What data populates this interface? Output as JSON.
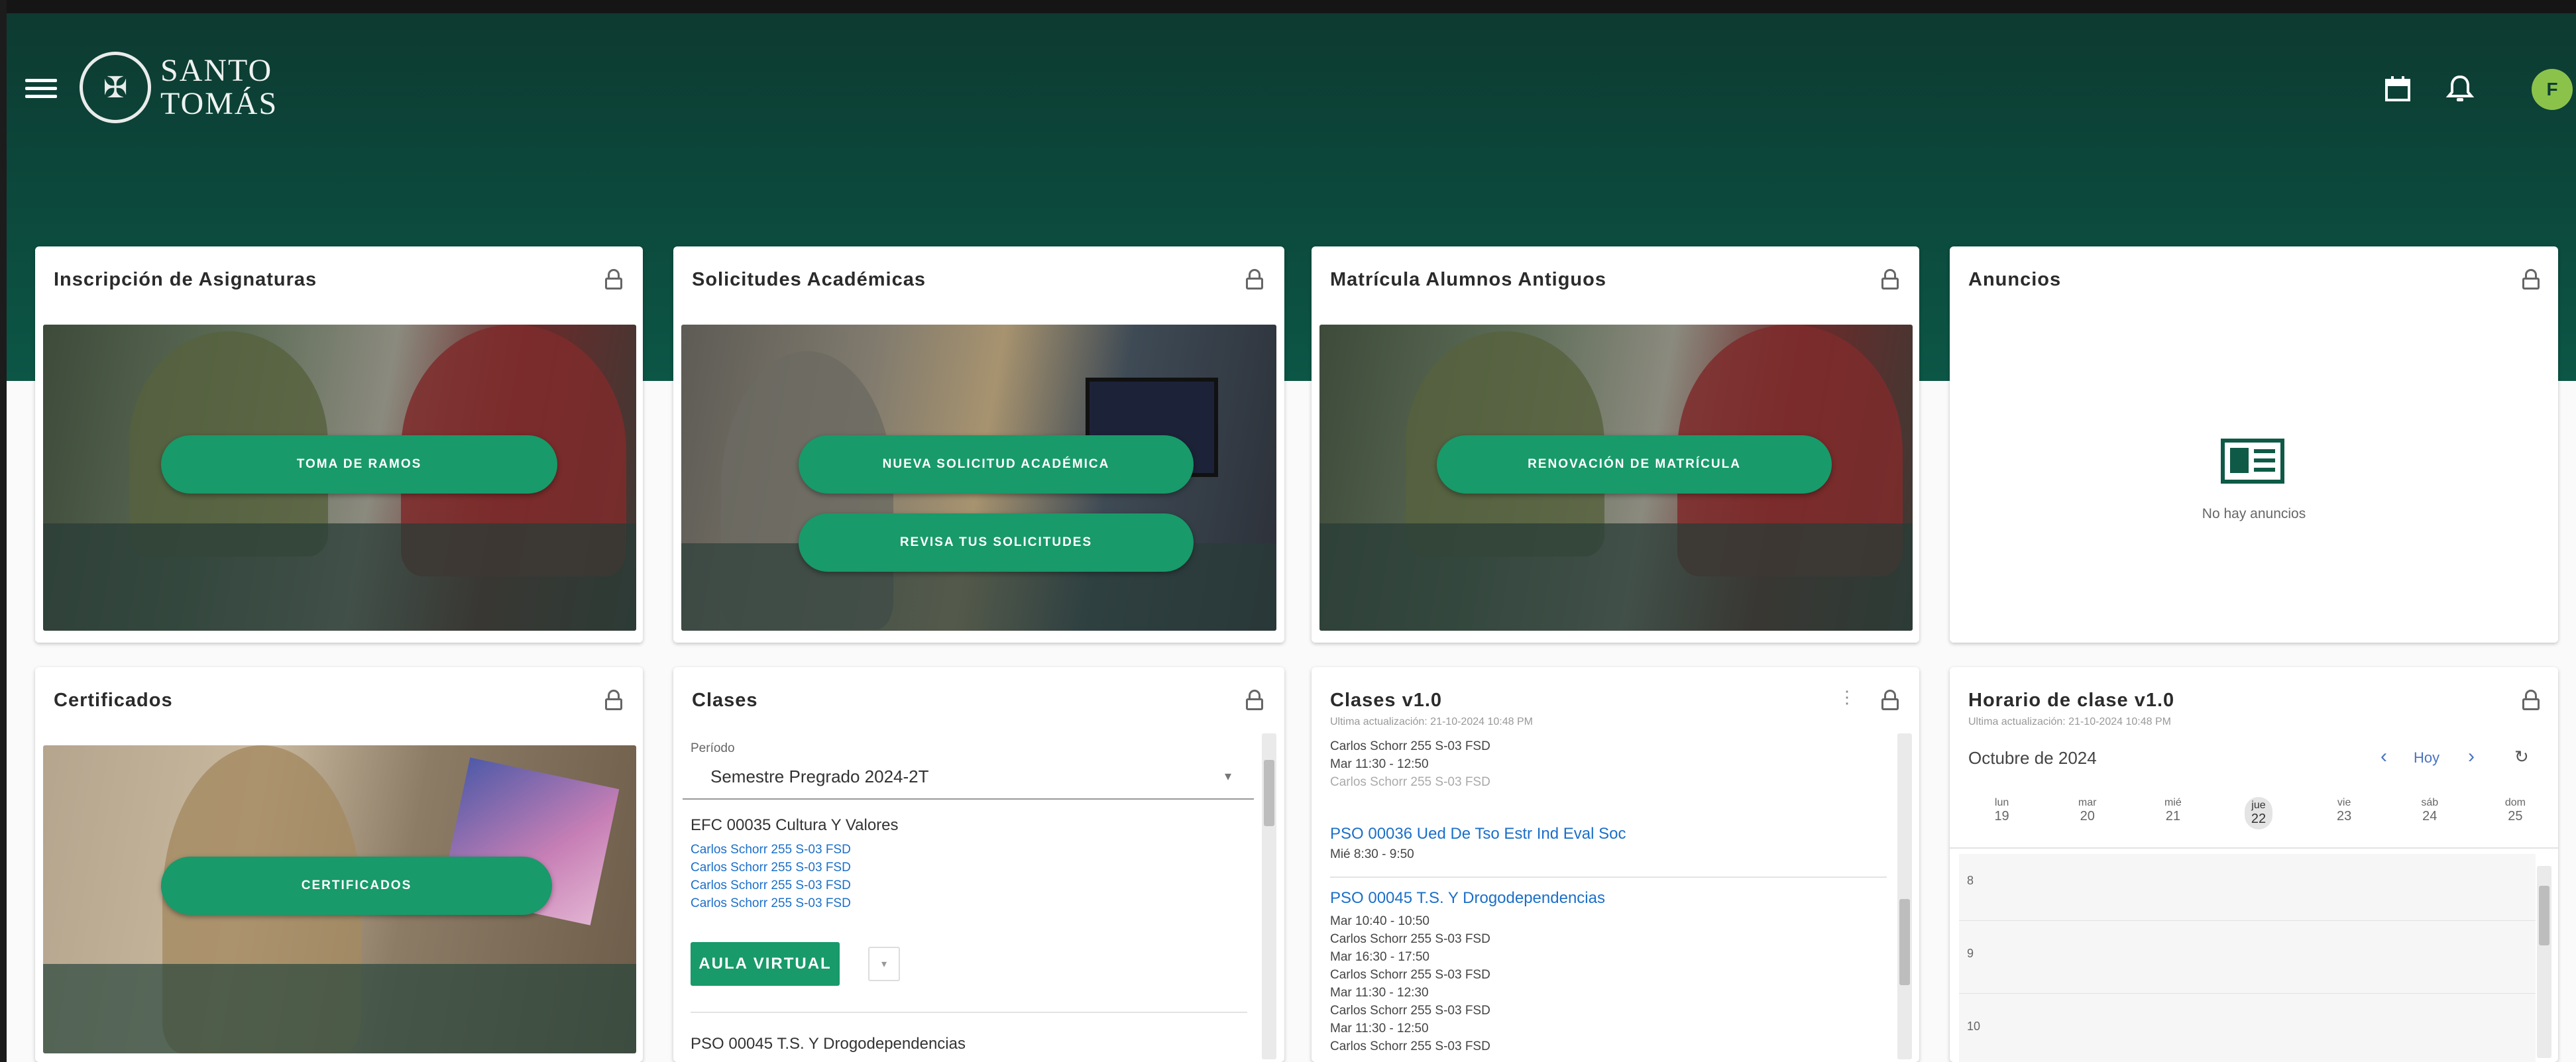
{
  "header": {
    "logo_line1": "SANTO",
    "logo_line2": "TOMÁS",
    "avatar_initial": "F",
    "icons": [
      "menu-icon",
      "calendar-icon",
      "bell-icon"
    ]
  },
  "colors": {
    "header": "#0c4a3d",
    "accent_button": "#189a6a",
    "avatar": "#8bc34a",
    "link": "#1b6fc9"
  },
  "cards": {
    "inscripcion": {
      "title": "Inscripción de Asignaturas",
      "button": "TOMA DE RAMOS"
    },
    "solicitudes": {
      "title": "Solicitudes Académicas",
      "button1": "NUEVA SOLICITUD ACADÉMICA",
      "button2": "REVISA TUS SOLICITUDES"
    },
    "matricula": {
      "title": "Matrícula Alumnos Antiguos",
      "button": "RENOVACIÓN DE MATRÍCULA"
    },
    "anuncios": {
      "title": "Anuncios",
      "empty": "No hay anuncios"
    },
    "certificados": {
      "title": "Certificados",
      "button": "CERTIFICADOS"
    },
    "clases": {
      "title": "Clases",
      "period_label": "Período",
      "period_value": "Semestre Pregrado 2024-2T",
      "course1": "EFC 00035 Cultura Y Valores",
      "course1_rooms": [
        "Carlos Schorr 255 S-03 FSD",
        "Carlos Schorr 255 S-03 FSD",
        "Carlos Schorr 255 S-03 FSD",
        "Carlos Schorr 255 S-03 FSD"
      ],
      "aula_button": "AULA VIRTUAL",
      "course2": "PSO 00045 T.S. Y Drogodependencias"
    },
    "clases_v1": {
      "title": "Clases v1.0",
      "subtitle": "Ultima actualización: 21-10-2024 10:48 PM",
      "lines_top": [
        "Carlos Schorr 255 S-03 FSD",
        "Mar 11:30 - 12:50",
        "Carlos Schorr 255 S-03 FSD"
      ],
      "course_a": "PSO 00036 Ued De Tso Estr Ind Eval Soc",
      "course_a_time": "Mié 8:30 - 9:50",
      "course_b": "PSO 00045 T.S. Y Drogodependencias",
      "course_b_lines": [
        "Mar 10:40 - 10:50",
        "Carlos Schorr 255 S-03 FSD",
        "Mar 16:30 - 17:50",
        "Carlos Schorr 255 S-03 FSD",
        "Mar 11:30 - 12:30",
        "Carlos Schorr 255 S-03 FSD",
        "Mar 11:30 - 12:50",
        "Carlos Schorr 255 S-03 FSD"
      ]
    },
    "horario": {
      "title": "Horario de clase v1.0",
      "subtitle": "Ultima actualización: 21-10-2024 10:48 PM",
      "month": "Octubre de 2024",
      "today_label": "Hoy",
      "days": [
        {
          "dow": "lun",
          "num": "19"
        },
        {
          "dow": "mar",
          "num": "20"
        },
        {
          "dow": "mié",
          "num": "21"
        },
        {
          "dow": "jue",
          "num": "22"
        },
        {
          "dow": "vie",
          "num": "23"
        },
        {
          "dow": "sáb",
          "num": "24"
        },
        {
          "dow": "dom",
          "num": "25"
        }
      ],
      "hours": [
        "8",
        "9",
        "10"
      ]
    }
  }
}
